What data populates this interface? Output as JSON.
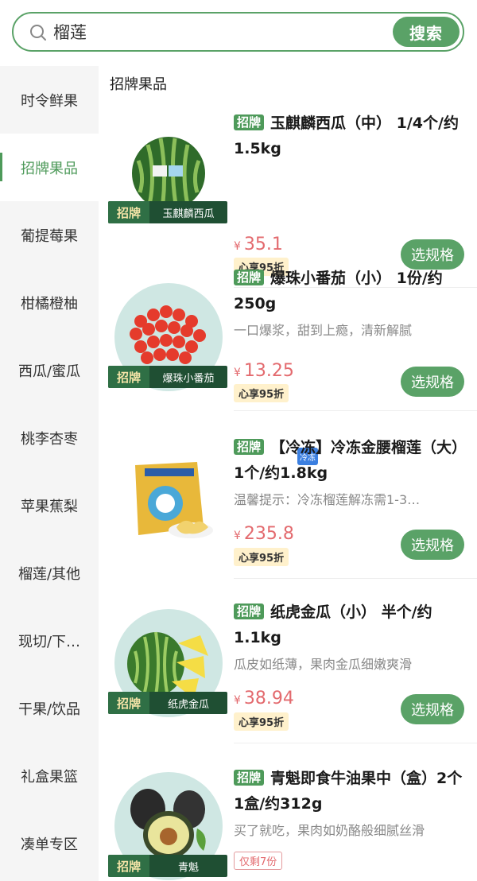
{
  "search": {
    "value": "榴莲",
    "button_label": "搜索"
  },
  "sidebar": {
    "items": [
      {
        "label": "时令鲜果",
        "active": false
      },
      {
        "label": "招牌果品",
        "active": true
      },
      {
        "label": "葡提莓果",
        "active": false
      },
      {
        "label": "柑橘橙柚",
        "active": false
      },
      {
        "label": "西瓜/蜜瓜",
        "active": false
      },
      {
        "label": "桃李杏枣",
        "active": false
      },
      {
        "label": "苹果蕉梨",
        "active": false
      },
      {
        "label": "榴莲/其他",
        "active": false
      },
      {
        "label": "现切/下…",
        "active": false
      },
      {
        "label": "干果/饮品",
        "active": false
      },
      {
        "label": "礼盒果篮",
        "active": false
      },
      {
        "label": "凑单专区",
        "active": false
      }
    ]
  },
  "main": {
    "section_title": "招牌果品",
    "products": [
      {
        "tag": "招牌",
        "title": "玉麒麟西瓜（中） 1/4个/约1.5kg",
        "desc": "",
        "price_symbol": "¥",
        "price": "35.1",
        "discount": "心享95折",
        "stock": "",
        "button_label": "选规格",
        "image_brand_tag": "招牌",
        "image_brand_name": "玉麒麟西瓜",
        "image_badge": ""
      },
      {
        "tag": "招牌",
        "title": "爆珠小番茄（小） 1份/约250g",
        "desc": "一口爆浆，甜到上瘾，清新解腻",
        "price_symbol": "¥",
        "price": "13.25",
        "discount": "心享95折",
        "stock": "",
        "button_label": "选规格",
        "image_brand_tag": "招牌",
        "image_brand_name": "爆珠小番茄",
        "image_badge": ""
      },
      {
        "tag": "招牌",
        "title": "【冷冻】冷冻金腰榴莲（大） 1个/约1.8kg",
        "desc": "温馨提示：冷冻榴莲解冻需1-3…",
        "price_symbol": "¥",
        "price": "235.8",
        "discount": "心享95折",
        "stock": "",
        "button_label": "选规格",
        "image_brand_tag": "",
        "image_brand_name": "",
        "image_badge": "冷冻"
      },
      {
        "tag": "招牌",
        "title": "纸虎金瓜（小） 半个/约1.1kg",
        "desc": "瓜皮如纸薄，果肉金瓜细嫩爽滑",
        "price_symbol": "¥",
        "price": "38.94",
        "discount": "心享95折",
        "stock": "",
        "button_label": "选规格",
        "image_brand_tag": "招牌",
        "image_brand_name": "纸虎金瓜",
        "image_badge": ""
      },
      {
        "tag": "招牌",
        "title": "青魁即食牛油果中（盒）2个 1盒/约312g",
        "desc": "买了就吃，果肉如奶酪般细腻丝滑",
        "price_symbol": "",
        "price": "",
        "discount": "",
        "stock": "仅剩7份",
        "button_label": "",
        "image_brand_tag": "招牌",
        "image_brand_name": "青魁",
        "image_badge": ""
      }
    ]
  },
  "colors": {
    "accent": "#5aa267",
    "price": "#e36a6e",
    "sidebar_bg": "#f5f5f5",
    "discount_bg": "#fff1cc"
  },
  "icons": {
    "search": "search-icon"
  }
}
